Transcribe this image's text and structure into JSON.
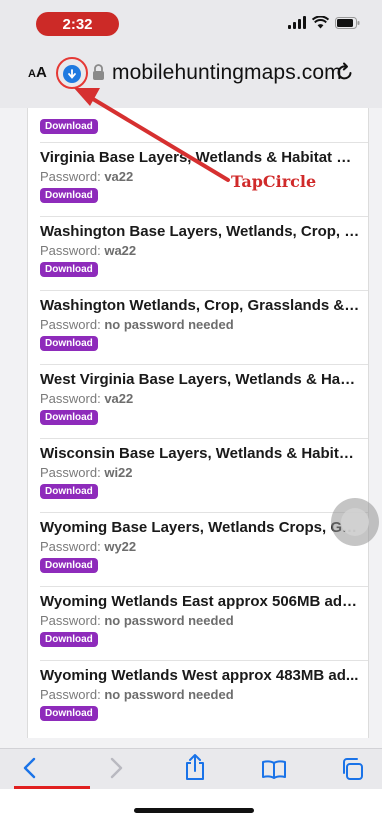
{
  "status": {
    "time": "2:32"
  },
  "urlbar": {
    "aa_small": "A",
    "aa_large": "A",
    "domain": "mobilehuntingmaps.com"
  },
  "annotation": {
    "label": "TapCircle"
  },
  "top_download_label": "Download",
  "password_label": "Password:",
  "items": [
    {
      "title": "Virginia Base Layers, Wetlands & Habitat Pu...",
      "password": "va22",
      "download": "Download"
    },
    {
      "title": "Washington Base Layers, Wetlands, Crop, G...",
      "password": "wa22",
      "download": "Download"
    },
    {
      "title": "Washington Wetlands, Crop, Grasslands & ...",
      "password": "no password needed",
      "download": "Download"
    },
    {
      "title": "West Virginia Base Layers, Wetlands & Habi...",
      "password": "va22",
      "download": "Download"
    },
    {
      "title": "Wisconsin Base Layers, Wetlands & Habitat ...",
      "password": "wi22",
      "download": "Download"
    },
    {
      "title": "Wyoming Base Layers, Wetlands Crops, Gra...",
      "password": "wy22",
      "download": "Download"
    },
    {
      "title": "Wyoming Wetlands East approx 506MB add...",
      "password": "no password needed",
      "download": "Download"
    },
    {
      "title": "Wyoming Wetlands West approx 483MB ad...",
      "password": "no password needed",
      "download": "Download"
    }
  ],
  "colors": {
    "download_badge": "#8e2bbb",
    "time_pill": "#cc2a27",
    "annotation": "#d02a2a",
    "accent_blue": "#1f7ae0"
  },
  "toolbar": {
    "icons": [
      "back-icon",
      "forward-icon",
      "share-icon",
      "bookmarks-icon",
      "tabs-icon"
    ]
  }
}
